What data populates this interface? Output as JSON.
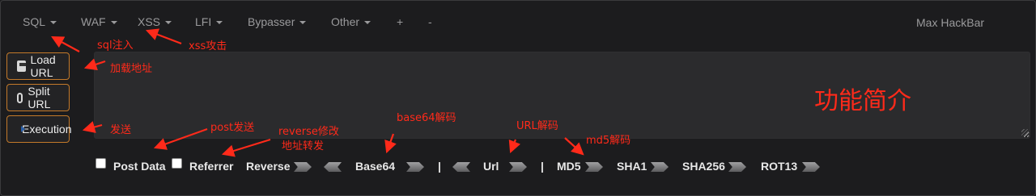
{
  "menu": {
    "items": [
      {
        "label": "SQL",
        "dropdown": true
      },
      {
        "label": "WAF",
        "dropdown": true
      },
      {
        "label": "XSS",
        "dropdown": true
      },
      {
        "label": "LFI",
        "dropdown": true
      },
      {
        "label": "Bypasser",
        "dropdown": true
      },
      {
        "label": "Other",
        "dropdown": true
      },
      {
        "label": "+",
        "dropdown": false
      },
      {
        "label": "-",
        "dropdown": false
      }
    ],
    "brand": "Max HackBar"
  },
  "actions": {
    "load": "Load URL",
    "split": "Split URL",
    "execute": "Execution"
  },
  "url_input": {
    "value": ""
  },
  "toolbar": {
    "post_data": "Post Data",
    "post_data_checked": false,
    "referrer": "Referrer",
    "referrer_checked": false,
    "reverse": "Reverse",
    "base64": "Base64",
    "separator": "|",
    "url": "Url",
    "md5": "MD5",
    "sha1": "SHA1",
    "sha256": "SHA256",
    "rot13": "ROT13"
  },
  "annotations": {
    "sql": "sql注入",
    "xss": "xss攻击",
    "load": "加载地址",
    "title": "功能简介",
    "post": "post发送",
    "execute": "发送",
    "reverse_line1": "reverse修改",
    "reverse_line2": "地址转发",
    "base64": "base64解码",
    "url": "URL解码",
    "md5": "md5解码"
  },
  "colors": {
    "background": "#1c1c1e",
    "button_border": "#c47a2a",
    "annotation": "#ff2a1a"
  }
}
